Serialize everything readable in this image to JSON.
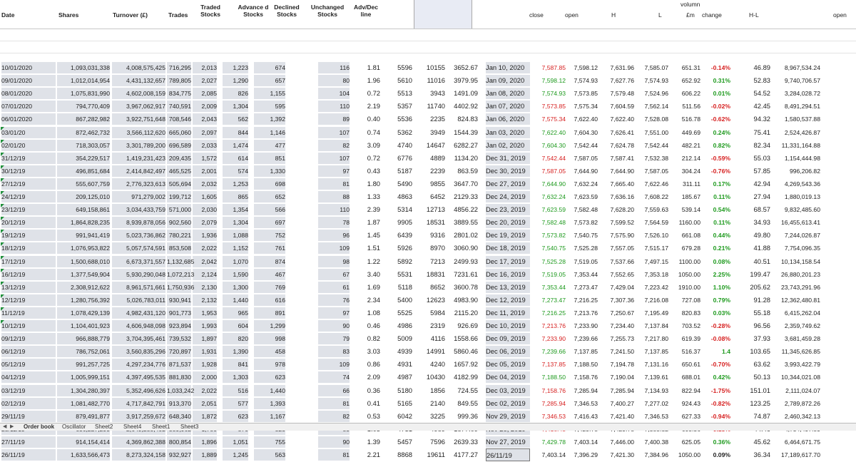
{
  "headers": {
    "date": "Date",
    "shares": "Shares",
    "turnover": "Turnover (£)",
    "trades": "Trades",
    "traded_stocks": "Traded Stocks",
    "advanced_stocks": "Advance d Stocks",
    "declined_stocks": "Declined Stocks",
    "unchanged_stocks": "Unchanged Stocks",
    "adv_dec_line": "Adv/Dec line",
    "close": "close",
    "open": "open",
    "high": "H",
    "low": "L",
    "volumn": "volumn",
    "volumn_unit": "£m",
    "change": "change",
    "hl": "H-L",
    "open2": "open"
  },
  "colors": {
    "negative": "#d61f1f",
    "positive": "#1e9a1e",
    "shade": "#dfe2e8",
    "selected_header": "#e8ebf4"
  },
  "rows": [
    {
      "date": "10/01/2020",
      "shares": "1,093,031,338",
      "turnover": "4,008,575,425",
      "trades": "716,295",
      "traded": "2,013",
      "adv": "1,223",
      "dec": "674",
      "unch": "116",
      "r": "1.81",
      "s": "5596",
      "t": "10155",
      "u": "3652.67",
      "day": "Jan 10, 2020",
      "close": "7,587.85",
      "open": "7,598.12",
      "high": "7,631.96",
      "low": "7,585.07",
      "vol": "651.31",
      "chg": "-0.14%",
      "hl": "46.89",
      "open2": "8,967,534.24",
      "marker": false,
      "cc": "red",
      "vc": "blk"
    },
    {
      "date": "09/01/2020",
      "shares": "1,012,014,954",
      "turnover": "4,431,132,657",
      "trades": "789,805",
      "traded": "2,027",
      "adv": "1,290",
      "dec": "657",
      "unch": "80",
      "r": "1.96",
      "s": "5610",
      "t": "11016",
      "u": "3979.95",
      "day": "Jan 09, 2020",
      "close": "7,598.12",
      "open": "7,574.93",
      "high": "7,627.76",
      "low": "7,574.93",
      "vol": "652.92",
      "chg": "0.31%",
      "hl": "52.83",
      "open2": "9,740,706.57",
      "marker": false,
      "cc": "grn",
      "vc": "blk"
    },
    {
      "date": "08/01/2020",
      "shares": "1,075,831,990",
      "turnover": "4,602,008,159",
      "trades": "834,775",
      "traded": "2,085",
      "adv": "826",
      "dec": "1,155",
      "unch": "104",
      "r": "0.72",
      "s": "5513",
      "t": "3943",
      "u": "1491.09",
      "day": "Jan 08, 2020",
      "close": "7,574.93",
      "open": "7,573.85",
      "high": "7,579.48",
      "low": "7,524.96",
      "vol": "606.22",
      "chg": "0.01%",
      "hl": "54.52",
      "open2": "3,284,028.72",
      "marker": false,
      "cc": "grn",
      "vc": "blk"
    },
    {
      "date": "07/01/2020",
      "shares": "794,770,409",
      "turnover": "3,967,062,917",
      "trades": "740,591",
      "traded": "2,009",
      "adv": "1,304",
      "dec": "595",
      "unch": "110",
      "r": "2.19",
      "s": "5357",
      "t": "11740",
      "u": "4402.92",
      "day": "Jan 07, 2020",
      "close": "7,573.85",
      "open": "7,575.34",
      "high": "7,604.59",
      "low": "7,562.14",
      "vol": "511.56",
      "chg": "-0.02%",
      "hl": "42.45",
      "open2": "8,491,294.51",
      "marker": false,
      "cc": "red",
      "vc": "blk"
    },
    {
      "date": "06/01/2020",
      "shares": "867,282,982",
      "turnover": "3,922,751,648",
      "trades": "708,546",
      "traded": "2,043",
      "adv": "562",
      "dec": "1,392",
      "unch": "89",
      "r": "0.40",
      "s": "5536",
      "t": "2235",
      "u": "824.83",
      "day": "Jan 06, 2020",
      "close": "7,575.34",
      "open": "7,622.40",
      "high": "7,622.40",
      "low": "7,528.08",
      "vol": "516.78",
      "chg": "-0.62%",
      "hl": "94.32",
      "open2": "1,580,537.88",
      "marker": false,
      "cc": "red",
      "vc": "blk"
    },
    {
      "date": "03/01/20",
      "shares": "872,462,732",
      "turnover": "3,566,112,620",
      "trades": "665,060",
      "traded": "2,097",
      "adv": "844",
      "dec": "1,146",
      "unch": "107",
      "r": "0.74",
      "s": "5362",
      "t": "3949",
      "u": "1544.39",
      "day": "Jan 03, 2020",
      "close": "7,622.40",
      "open": "7,604.30",
      "high": "7,626.41",
      "low": "7,551.00",
      "vol": "449.69",
      "chg": "0.24%",
      "hl": "75.41",
      "open2": "2,524,426.87",
      "marker": true,
      "cc": "grn",
      "vc": "blk"
    },
    {
      "date": "02/01/20",
      "shares": "718,303,057",
      "turnover": "3,301,789,200",
      "trades": "696,589",
      "traded": "2,033",
      "adv": "1,474",
      "dec": "477",
      "unch": "82",
      "r": "3.09",
      "s": "4740",
      "t": "14647",
      "u": "6282.27",
      "day": "Jan 02, 2020",
      "close": "7,604.30",
      "open": "7,542.44",
      "high": "7,624.78",
      "low": "7,542.44",
      "vol": "482.21",
      "chg": "0.82%",
      "hl": "82.34",
      "open2": "11,331,164.88",
      "marker": true,
      "cc": "grn",
      "vc": "blk"
    },
    {
      "date": "31/12/19",
      "shares": "354,229,517",
      "turnover": "1,419,231,423",
      "trades": "209,435",
      "traded": "1,572",
      "adv": "614",
      "dec": "851",
      "unch": "107",
      "r": "0.72",
      "s": "6776",
      "t": "4889",
      "u": "1134.20",
      "day": "Dec 31, 2019",
      "close": "7,542.44",
      "open": "7,587.05",
      "high": "7,587.41",
      "low": "7,532.38",
      "vol": "212.14",
      "chg": "-0.59%",
      "hl": "55.03",
      "open2": "1,154,444.98",
      "marker": true,
      "cc": "red",
      "vc": "blk"
    },
    {
      "date": "30/12/19",
      "shares": "496,851,684",
      "turnover": "2,414,842,497",
      "trades": "465,525",
      "traded": "2,001",
      "adv": "574",
      "dec": "1,330",
      "unch": "97",
      "r": "0.43",
      "s": "5187",
      "t": "2239",
      "u": "863.59",
      "day": "Dec 30, 2019",
      "close": "7,587.05",
      "open": "7,644.90",
      "high": "7,644.90",
      "low": "7,587.05",
      "vol": "304.24",
      "chg": "-0.76%",
      "hl": "57.85",
      "open2": "996,206.82",
      "marker": true,
      "cc": "red",
      "vc": "blk"
    },
    {
      "date": "27/12/19",
      "shares": "555,607,759",
      "turnover": "2,776,323,613",
      "trades": "505,694",
      "traded": "2,032",
      "adv": "1,253",
      "dec": "698",
      "unch": "81",
      "r": "1.80",
      "s": "5490",
      "t": "9855",
      "u": "3647.70",
      "day": "Dec 27, 2019",
      "close": "7,644.90",
      "open": "7,632.24",
      "high": "7,665.40",
      "low": "7,622.46",
      "vol": "311.11",
      "chg": "0.17%",
      "hl": "42.94",
      "open2": "4,269,543.36",
      "marker": true,
      "cc": "grn",
      "vc": "blk"
    },
    {
      "date": "24/12/19",
      "shares": "209,125,010",
      "turnover": "971,279,002",
      "trades": "199,712",
      "traded": "1,605",
      "adv": "865",
      "dec": "652",
      "unch": "88",
      "r": "1.33",
      "s": "4863",
      "t": "6452",
      "u": "2129.33",
      "day": "Dec 24, 2019",
      "close": "7,632.24",
      "open": "7,623.59",
      "high": "7,636.16",
      "low": "7,608.22",
      "vol": "185.67",
      "chg": "0.11%",
      "hl": "27.94",
      "open2": "1,880,019.13",
      "marker": true,
      "cc": "grn",
      "vc": "blk"
    },
    {
      "date": "23/12/19",
      "shares": "649,158,861",
      "turnover": "3,034,433,759",
      "trades": "571,000",
      "traded": "2,030",
      "adv": "1,354",
      "dec": "566",
      "unch": "110",
      "r": "2.39",
      "s": "5314",
      "t": "12713",
      "u": "4856.22",
      "day": "Dec 23, 2019",
      "close": "7,623.59",
      "open": "7,582.48",
      "high": "7,628.20",
      "low": "7,559.63",
      "vol": "539.14",
      "chg": "0.54%",
      "hl": "68.57",
      "open2": "9,832,485.60",
      "marker": true,
      "cc": "grn",
      "vc": "blk"
    },
    {
      "date": "20/12/19",
      "shares": "1,864,828,235",
      "turnover": "8,939,878,056",
      "trades": "902,560",
      "traded": "2,079",
      "adv": "1,304",
      "dec": "697",
      "unch": "78",
      "r": "1.87",
      "s": "9905",
      "t": "18531",
      "u": "3889.55",
      "day": "Dec 20, 2019",
      "close": "7,582.48",
      "open": "7,573.82",
      "high": "7,599.52",
      "low": "7,564.59",
      "vol": "1160.00",
      "chg": "0.11%",
      "hl": "34.93",
      "open2": "16,455,613.41",
      "marker": true,
      "cc": "grn",
      "vc": "blk"
    },
    {
      "date": "19/12/19",
      "shares": "991,941,419",
      "turnover": "5,023,736,862",
      "trades": "780,221",
      "traded": "1,936",
      "adv": "1,088",
      "dec": "752",
      "unch": "96",
      "r": "1.45",
      "s": "6439",
      "t": "9316",
      "u": "2801.02",
      "day": "Dec 19, 2019",
      "close": "7,573.82",
      "open": "7,540.75",
      "high": "7,575.90",
      "low": "7,526.10",
      "vol": "661.08",
      "chg": "0.44%",
      "hl": "49.80",
      "open2": "7,244,026.87",
      "marker": true,
      "cc": "grn",
      "vc": "blk"
    },
    {
      "date": "18/12/19",
      "shares": "1,076,953,822",
      "turnover": "5,057,574,591",
      "trades": "853,508",
      "traded": "2,022",
      "adv": "1,152",
      "dec": "761",
      "unch": "109",
      "r": "1.51",
      "s": "5926",
      "t": "8970",
      "u": "3060.90",
      "day": "Dec 18, 2019",
      "close": "7,540.75",
      "open": "7,525.28",
      "high": "7,557.05",
      "low": "7,515.17",
      "vol": "679.28",
      "chg": "0.21%",
      "hl": "41.88",
      "open2": "7,754,096.35",
      "marker": true,
      "cc": "grn",
      "vc": "blk"
    },
    {
      "date": "17/12/19",
      "shares": "1,500,688,010",
      "turnover": "6,673,371,557",
      "trades": "1,132,685",
      "traded": "2,042",
      "adv": "1,070",
      "dec": "874",
      "unch": "98",
      "r": "1.22",
      "s": "5892",
      "t": "7213",
      "u": "2499.93",
      "day": "Dec 17, 2019",
      "close": "7,525.28",
      "open": "7,519.05",
      "high": "7,537.66",
      "low": "7,497.15",
      "vol": "1100.00",
      "chg": "0.08%",
      "hl": "40.51",
      "open2": "10,134,158.54",
      "marker": true,
      "cc": "grn",
      "vc": "blk"
    },
    {
      "date": "16/12/19",
      "shares": "1,377,549,904",
      "turnover": "5,930,290,048",
      "trades": "1,072,213",
      "traded": "2,124",
      "adv": "1,590",
      "dec": "467",
      "unch": "67",
      "r": "3.40",
      "s": "5531",
      "t": "18831",
      "u": "7231.61",
      "day": "Dec 16, 2019",
      "close": "7,519.05",
      "open": "7,353.44",
      "high": "7,552.65",
      "low": "7,353.18",
      "vol": "1050.00",
      "chg": "2.25%",
      "hl": "199.47",
      "open2": "26,880,201.23",
      "marker": true,
      "cc": "grn",
      "vc": "blk"
    },
    {
      "date": "13/12/19",
      "shares": "2,308,912,622",
      "turnover": "8,961,571,661",
      "trades": "1,750,936",
      "traded": "2,130",
      "adv": "1,300",
      "dec": "769",
      "unch": "61",
      "r": "1.69",
      "s": "5118",
      "t": "8652",
      "u": "3600.78",
      "day": "Dec 13, 2019",
      "close": "7,353.44",
      "open": "7,273.47",
      "high": "7,429.04",
      "low": "7,223.42",
      "vol": "1910.00",
      "chg": "1.10%",
      "hl": "205.62",
      "open2": "23,743,291.96",
      "marker": true,
      "cc": "grn",
      "vc": "blk"
    },
    {
      "date": "12/12/19",
      "shares": "1,280,756,392",
      "turnover": "5,026,783,011",
      "trades": "930,941",
      "traded": "2,132",
      "adv": "1,440",
      "dec": "616",
      "unch": "76",
      "r": "2.34",
      "s": "5400",
      "t": "12623",
      "u": "4983.90",
      "day": "Dec 12, 2019",
      "close": "7,273.47",
      "open": "7,216.25",
      "high": "7,307.36",
      "low": "7,216.08",
      "vol": "727.08",
      "chg": "0.79%",
      "hl": "91.28",
      "open2": "12,362,480.81",
      "marker": true,
      "cc": "grn",
      "vc": "blk"
    },
    {
      "date": "11/12/19",
      "shares": "1,078,429,139",
      "turnover": "4,982,431,120",
      "trades": "901,773",
      "traded": "1,953",
      "adv": "965",
      "dec": "891",
      "unch": "97",
      "r": "1.08",
      "s": "5525",
      "t": "5984",
      "u": "2115.20",
      "day": "Dec 11, 2019",
      "close": "7,216.25",
      "open": "7,213.76",
      "high": "7,250.67",
      "low": "7,195.49",
      "vol": "820.83",
      "chg": "0.03%",
      "hl": "55.18",
      "open2": "6,415,262.04",
      "marker": true,
      "cc": "grn",
      "vc": "blk"
    },
    {
      "date": "10/12/19",
      "shares": "1,104,401,923",
      "turnover": "4,606,948,098",
      "trades": "923,894",
      "traded": "1,993",
      "adv": "604",
      "dec": "1,299",
      "unch": "90",
      "r": "0.46",
      "s": "4986",
      "t": "2319",
      "u": "926.69",
      "day": "Dec 10, 2019",
      "close": "7,213.76",
      "open": "7,233.90",
      "high": "7,234.40",
      "low": "7,137.84",
      "vol": "703.52",
      "chg": "-0.28%",
      "hl": "96.56",
      "open2": "2,359,749.62",
      "marker": true,
      "cc": "red",
      "vc": "blk"
    },
    {
      "date": "09/12/19",
      "shares": "966,888,779",
      "turnover": "3,704,395,461",
      "trades": "739,532",
      "traded": "1,897",
      "adv": "820",
      "dec": "998",
      "unch": "79",
      "r": "0.82",
      "s": "5009",
      "t": "4116",
      "u": "1558.66",
      "day": "Dec 09, 2019",
      "close": "7,233.90",
      "open": "7,239.66",
      "high": "7,255.73",
      "low": "7,217.80",
      "vol": "619.39",
      "chg": "-0.08%",
      "hl": "37.93",
      "open2": "3,681,459.28",
      "marker": false,
      "cc": "red",
      "vc": "blk"
    },
    {
      "date": "06/12/19",
      "shares": "786,752,061",
      "turnover": "3,560,835,296",
      "trades": "720,897",
      "traded": "1,931",
      "adv": "1,390",
      "dec": "458",
      "unch": "83",
      "r": "3.03",
      "s": "4939",
      "t": "14991",
      "u": "5860.46",
      "day": "Dec 06, 2019",
      "close": "7,239.66",
      "open": "7,137.85",
      "high": "7,241.50",
      "low": "7,137.85",
      "vol": "516.37",
      "chg": "1.4",
      "hl": "103.65",
      "open2": "11,345,626.85",
      "marker": false,
      "cc": "grn",
      "vc": "blk"
    },
    {
      "date": "05/12/19",
      "shares": "991,257,725",
      "turnover": "4,297,234,776",
      "trades": "871,537",
      "traded": "1,928",
      "adv": "841",
      "dec": "978",
      "unch": "109",
      "r": "0.86",
      "s": "4931",
      "t": "4240",
      "u": "1657.92",
      "day": "Dec 05, 2019",
      "close": "7,137.85",
      "open": "7,188.50",
      "high": "7,194.78",
      "low": "7,131.16",
      "vol": "650.61",
      "chg": "-0.70%",
      "hl": "63.62",
      "open2": "3,993,422.79",
      "marker": false,
      "cc": "red",
      "vc": "blk"
    },
    {
      "date": "04/12/19",
      "shares": "1,005,999,151",
      "turnover": "4,397,495,535",
      "trades": "881,830",
      "traded": "2,000",
      "adv": "1,303",
      "dec": "623",
      "unch": "74",
      "r": "2.09",
      "s": "4987",
      "t": "10430",
      "u": "4182.99",
      "day": "Dec 04, 2019",
      "close": "7,188.50",
      "open": "7,158.76",
      "high": "7,190.04",
      "low": "7,139.61",
      "vol": "688.01",
      "chg": "0.42%",
      "hl": "50.13",
      "open2": "10,344,021.08",
      "marker": false,
      "cc": "grn",
      "vc": "blk"
    },
    {
      "date": "03/12/19",
      "shares": "1,304,280,397",
      "turnover": "5,352,496,626",
      "trades": "1,033,242",
      "traded": "2,022",
      "adv": "516",
      "dec": "1,440",
      "unch": "66",
      "r": "0.36",
      "s": "5180",
      "t": "1856",
      "u": "724.55",
      "day": "Dec 03, 2019",
      "close": "7,158.76",
      "open": "7,285.94",
      "high": "7,285.94",
      "low": "7,134.93",
      "vol": "822.94",
      "chg": "-1.75%",
      "hl": "151.01",
      "open2": "2,111,024.07",
      "marker": false,
      "cc": "red",
      "vc": "blk"
    },
    {
      "date": "02/12/19",
      "shares": "1,081,482,770",
      "turnover": "4,717,842,791",
      "trades": "913,370",
      "traded": "2,051",
      "adv": "577",
      "dec": "1,393",
      "unch": "81",
      "r": "0.41",
      "s": "5165",
      "t": "2140",
      "u": "849.55",
      "day": "Dec 02, 2019",
      "close": "7,285.94",
      "open": "7,346.53",
      "high": "7,400.27",
      "low": "7,277.02",
      "vol": "924.43",
      "chg": "-0.82%",
      "hl": "123.25",
      "open2": "2,789,872.26",
      "marker": false,
      "cc": "red",
      "vc": "blk"
    },
    {
      "date": "29/11/19",
      "shares": "879,491,877",
      "turnover": "3,917,259,672",
      "trades": "648,340",
      "traded": "1,872",
      "adv": "623",
      "dec": "1,167",
      "unch": "82",
      "r": "0.53",
      "s": "6042",
      "t": "3225",
      "u": "999.36",
      "day": "Nov 29, 2019",
      "close": "7,346.53",
      "open": "7,416.43",
      "high": "7,421.40",
      "low": "7,346.53",
      "vol": "627.33",
      "chg": "-0.94%",
      "hl": "74.87",
      "open2": "2,460,342.13",
      "marker": false,
      "cc": "red",
      "vc": "blk"
    },
    {
      "date": "28/11/19",
      "shares": "636,227,293",
      "turnover": "2,649,255,402",
      "trades": "559,962",
      "traded": "1,780",
      "adv": "870",
      "dec": "825",
      "unch": "85",
      "r": "1.05",
      "s": "4731",
      "t": "4989",
      "u": "1877.09",
      "day": "Nov 28, 2019",
      "close": "7,416.43",
      "open": "7,429.78",
      "high": "7,429.78",
      "low": "7,385.32",
      "vol": "605.36",
      "chg": "-0.18%",
      "hl": "44.46",
      "open2": "4,734,497.89",
      "marker": false,
      "cc": "red",
      "vc": "blk"
    },
    {
      "date": "27/11/19",
      "shares": "914,154,414",
      "turnover": "4,369,862,388",
      "trades": "800,854",
      "traded": "1,896",
      "adv": "1,051",
      "dec": "755",
      "unch": "90",
      "r": "1.39",
      "s": "5457",
      "t": "7596",
      "u": "2639.33",
      "day": "Nov 27, 2019",
      "close": "7,429.78",
      "open": "7,403.14",
      "high": "7,446.00",
      "low": "7,400.38",
      "vol": "625.05",
      "chg": "0.36%",
      "hl": "45.62",
      "open2": "6,464,671.75",
      "marker": false,
      "cc": "grn",
      "vc": "blk"
    },
    {
      "date": "26/11/19",
      "shares": "1,633,566,473",
      "turnover": "8,273,324,158",
      "trades": "932,927",
      "traded": "1,889",
      "adv": "1,245",
      "dec": "563",
      "unch": "81",
      "r": "2.21",
      "s": "8868",
      "t": "19611",
      "u": "4177.27",
      "day": "26/11/19",
      "close": "7,403.14",
      "open": "7,396.29",
      "high": "7,421.30",
      "low": "7,384.96",
      "vol": "1050.00",
      "chg": "0.09%",
      "hl": "36.34",
      "open2": "17,189,617.70",
      "marker": false,
      "cc": "blk",
      "vc": "blk"
    }
  ],
  "sheet_tabs": [
    {
      "label": "Order book",
      "active": true
    },
    {
      "label": "Oscillator",
      "active": false
    },
    {
      "label": "Sheet2",
      "active": false
    },
    {
      "label": "Sheet4",
      "active": false
    },
    {
      "label": "Sheet1",
      "active": false
    },
    {
      "label": "Sheet3",
      "active": false
    }
  ]
}
